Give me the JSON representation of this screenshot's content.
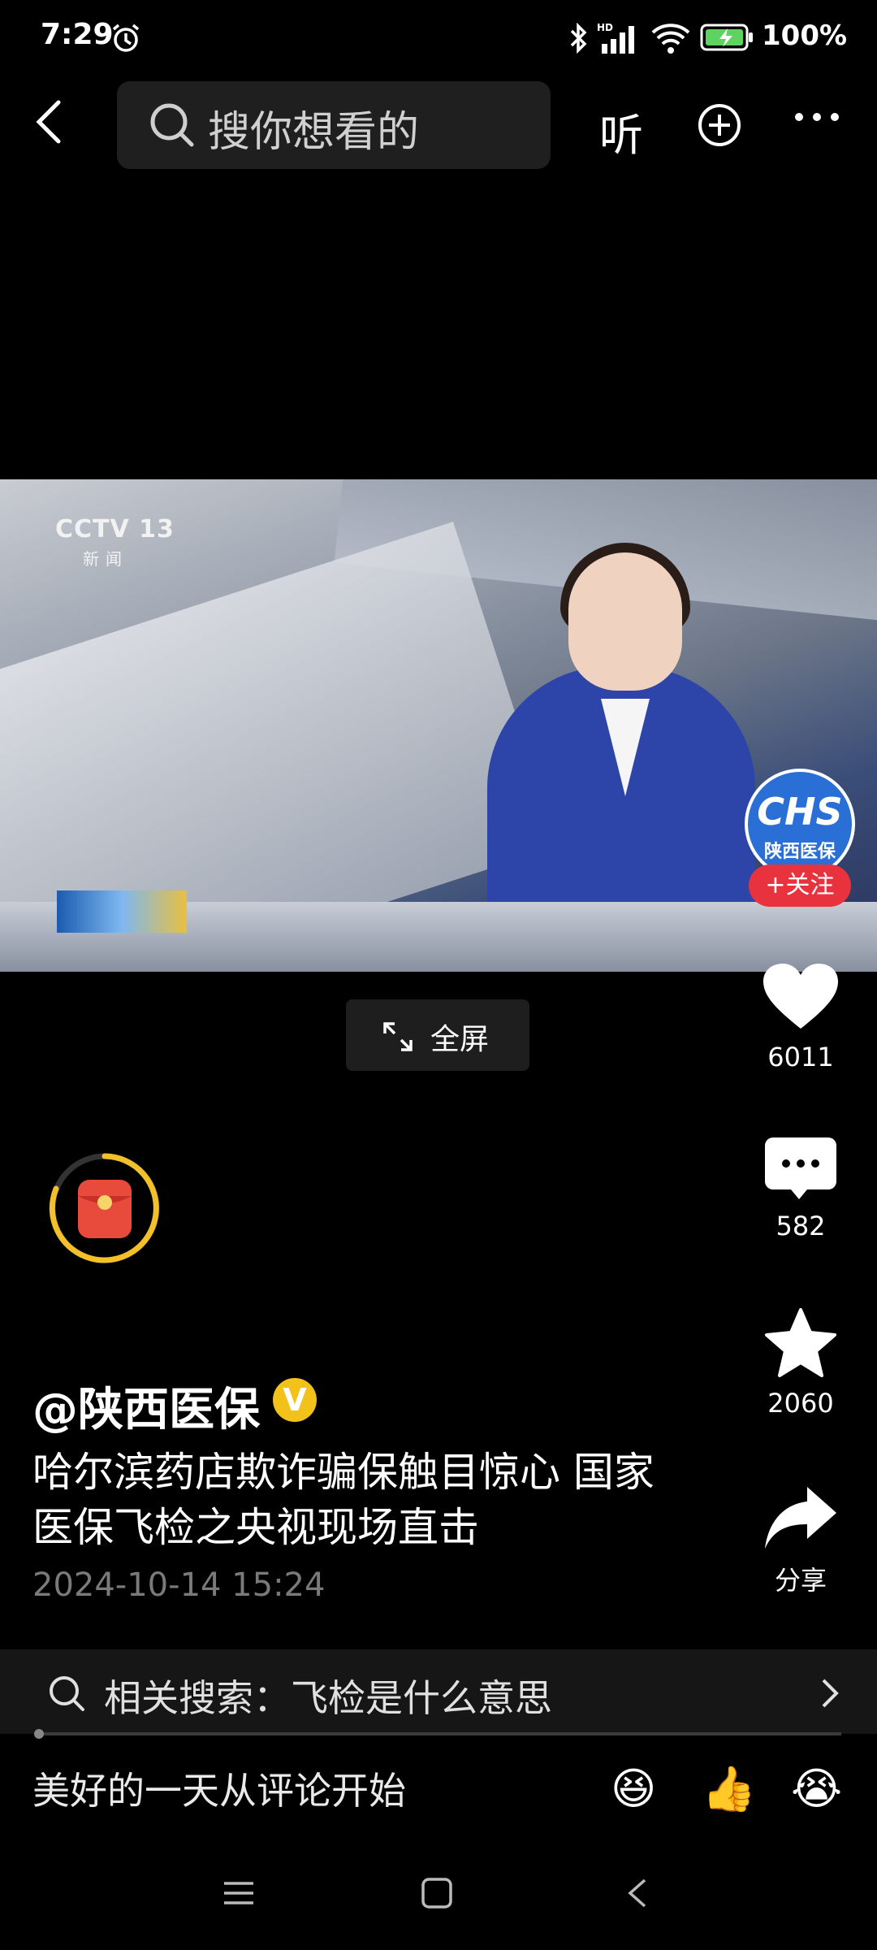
{
  "status_bar": {
    "time": "7:29",
    "battery": "100%",
    "icons": [
      "alarm-icon",
      "bluetooth-icon",
      "hd-signal-icon",
      "wifi-icon",
      "battery-charging-icon"
    ]
  },
  "top_bar": {
    "search_placeholder": "搜你想看的",
    "listen_label": "听"
  },
  "video": {
    "channel_logo": "CCTV 13",
    "channel_sub": "新闻",
    "fullscreen_label": "全屏"
  },
  "account": {
    "avatar_logo": "CHS",
    "avatar_name": "陕西医保",
    "follow_label": "+关注"
  },
  "actions": {
    "likes": "6011",
    "comments": "582",
    "favorites": "2060",
    "share_label": "分享"
  },
  "post": {
    "author": "@陕西医保",
    "verified_badge": "V",
    "title": "哈尔滨药店欺诈骗保触目惊心 国家医保飞检之央视现场直击",
    "date": "2024-10-14 15:24"
  },
  "related_search": {
    "text": "相关搜索：飞检是什么意思"
  },
  "comment_bar": {
    "placeholder": "美好的一天从评论开始",
    "emojis": [
      "😆",
      "👍",
      "😭"
    ]
  },
  "colors": {
    "follow_red": "#e8333f",
    "verified_gold": "#f2c21b",
    "avatar_blue": "#2a6fd6"
  }
}
